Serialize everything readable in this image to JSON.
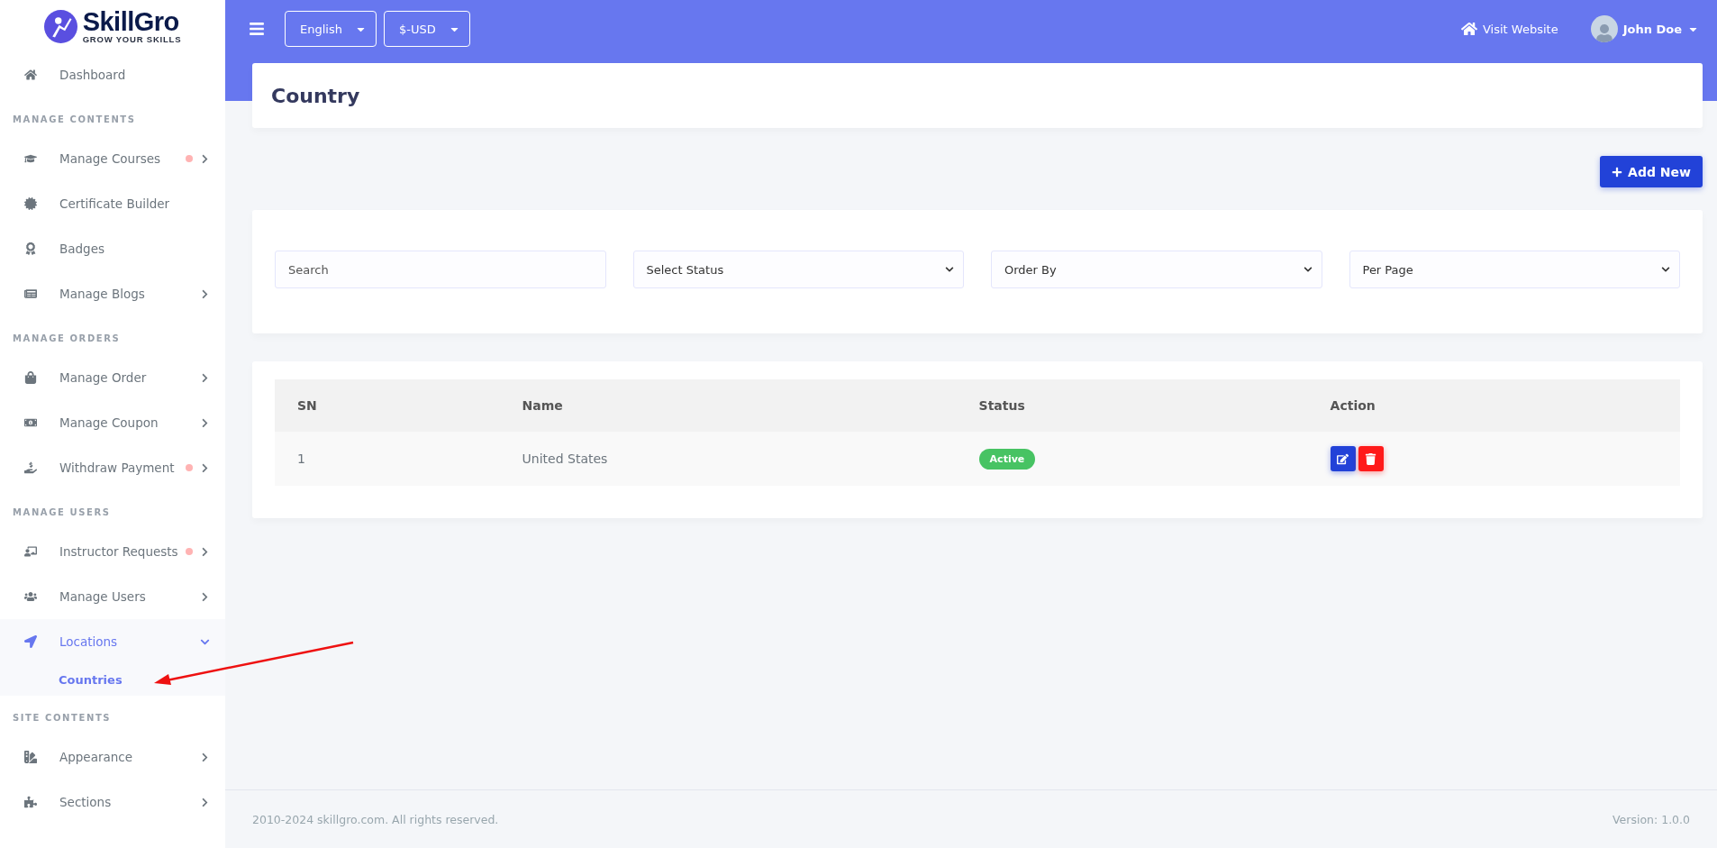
{
  "brand": {
    "name": "SkillGro",
    "tagline": "GROW YOUR SKILLS"
  },
  "sidebar": {
    "groups": [
      {
        "items": [
          {
            "label": "Dashboard",
            "kind": "link",
            "selected": false,
            "notification": false
          }
        ]
      },
      {
        "heading": "MANAGE CONTENTS",
        "items": [
          {
            "label": "Manage Courses",
            "kind": "menu",
            "expanded": false,
            "selected": false,
            "notification": true
          },
          {
            "label": "Certificate Builder",
            "kind": "link",
            "selected": false,
            "notification": false
          },
          {
            "label": "Badges",
            "kind": "link",
            "selected": false,
            "notification": false
          },
          {
            "label": "Manage Blogs",
            "kind": "menu",
            "expanded": false,
            "selected": false,
            "notification": false
          }
        ]
      },
      {
        "heading": "MANAGE ORDERS",
        "items": [
          {
            "label": "Manage Order",
            "kind": "menu",
            "expanded": false,
            "selected": false,
            "notification": false
          },
          {
            "label": "Manage Coupon",
            "kind": "menu",
            "expanded": false,
            "selected": false,
            "notification": false
          },
          {
            "label": "Withdraw Payment",
            "kind": "menu",
            "expanded": false,
            "selected": false,
            "notification": true
          }
        ]
      },
      {
        "heading": "MANAGE USERS",
        "items": [
          {
            "label": "Instructor Requests",
            "kind": "menu",
            "expanded": false,
            "selected": false,
            "notification": true
          },
          {
            "label": "Manage Users",
            "kind": "menu",
            "expanded": false,
            "selected": false,
            "notification": false
          },
          {
            "label": "Locations",
            "kind": "menu",
            "expanded": true,
            "selected": true,
            "notification": false,
            "children": [
              {
                "label": "Countries",
                "selected": true
              }
            ]
          }
        ]
      },
      {
        "heading": "SITE CONTENTS",
        "items": [
          {
            "label": "Appearance",
            "kind": "menu",
            "expanded": false,
            "selected": false,
            "notification": false
          },
          {
            "label": "Sections",
            "kind": "menu",
            "expanded": false,
            "selected": false,
            "notification": false
          }
        ]
      }
    ]
  },
  "topbar": {
    "language": "English",
    "currency": "$-USD",
    "visit_link": "Visit Website",
    "user": "John Doe"
  },
  "page": {
    "title": "Country",
    "add_button": "Add New"
  },
  "filters": {
    "search": {
      "placeholder": "Search"
    },
    "selects": [
      "Select Status",
      "Order By",
      "Per Page"
    ]
  },
  "table": {
    "columns": [
      "SN",
      "Name",
      "Status",
      "Action"
    ],
    "rows": [
      {
        "sn": "1",
        "name": "United States",
        "status": "Active",
        "active": true
      }
    ]
  },
  "footer": {
    "copyright": "2010-2024 skillgro.com. All rights reserved.",
    "version": "Version: 1.0.0"
  }
}
